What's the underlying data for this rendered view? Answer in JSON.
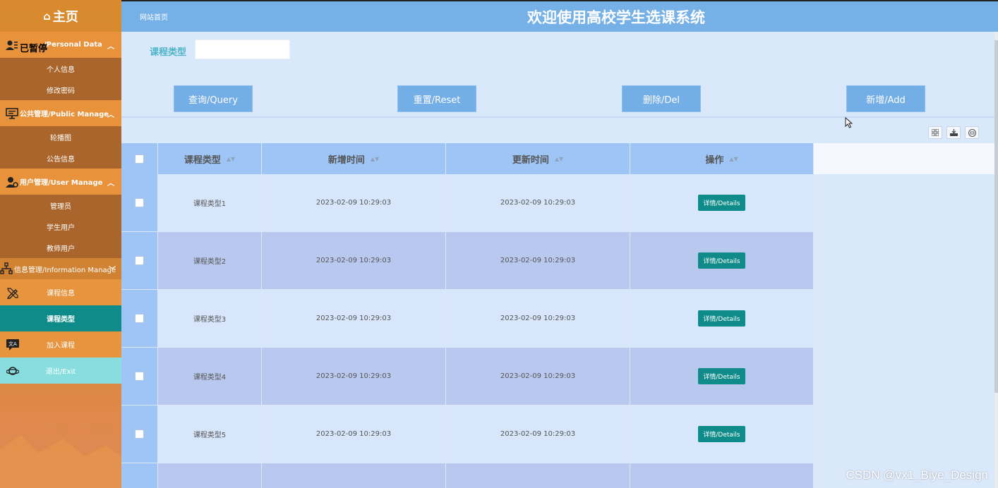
{
  "sidebar": {
    "home": "主页",
    "overlay": "已暂停",
    "groups": [
      {
        "header": "/Personal Data",
        "items": [
          "个人信息",
          "修改密码"
        ]
      },
      {
        "header": "公共管理/Public Manage",
        "items": [
          "轮播图",
          "公告信息"
        ]
      },
      {
        "header": "用户管理/User Manage",
        "items": [
          "管理员",
          "学生用户",
          "教师用户"
        ]
      }
    ],
    "info_header": "信息管理/Information Manage",
    "info_items": [
      "课程信息",
      "课程类型",
      "加入课程"
    ],
    "exit": "退出/Exit"
  },
  "header": {
    "crumb": "网站首页",
    "title": "欢迎使用高校学生选课系统"
  },
  "search": {
    "label": "课程类型",
    "value": "",
    "placeholder": ""
  },
  "buttons": {
    "query": "查询/Query",
    "reset": "重置/Reset",
    "del": "删除/Del",
    "add": "新增/Add"
  },
  "table": {
    "columns": [
      "课程类型",
      "新增时间",
      "更新时间",
      "操作"
    ],
    "details_label": "详情/Details",
    "rows": [
      {
        "type": "课程类型1",
        "added": "2023-02-09 10:29:03",
        "updated": "2023-02-09 10:29:03"
      },
      {
        "type": "课程类型2",
        "added": "2023-02-09 10:29:03",
        "updated": "2023-02-09 10:29:03"
      },
      {
        "type": "课程类型3",
        "added": "2023-02-09 10:29:03",
        "updated": "2023-02-09 10:29:03"
      },
      {
        "type": "课程类型4",
        "added": "2023-02-09 10:29:03",
        "updated": "2023-02-09 10:29:03"
      },
      {
        "type": "课程类型5",
        "added": "2023-02-09 10:29:03",
        "updated": "2023-02-09 10:29:03"
      }
    ]
  },
  "watermark": "CSDN @vx1_Biye_Design"
}
